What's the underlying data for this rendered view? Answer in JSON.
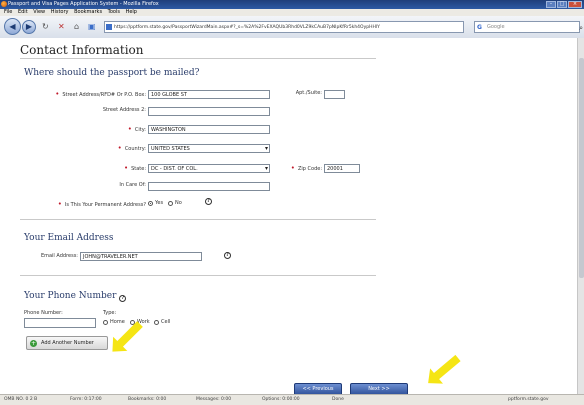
{
  "window": {
    "title": "Passport and Visa Pages Application System - Mozilla Firefox"
  },
  "menu": [
    "File",
    "Edit",
    "View",
    "History",
    "Bookmarks",
    "Tools",
    "Help"
  ],
  "browser": {
    "url": "https://pptform.state.gov/PassportWizardMain.aspx#?_s=%2A%2FvEXAQUb3Rhd0VLZ9kCAuB7pNIpKfRr5kh4OypHHlY",
    "search_placeholder": "Google",
    "search_badge": "G"
  },
  "page": {
    "title": "Contact Information",
    "mailing": {
      "heading": "Where should the passport be mailed?",
      "street_label": "Street Address/RFD# Or P.O. Box:",
      "street_value": "100 GLOBE ST",
      "apt_label": "Apt./Suite:",
      "apt_value": "",
      "street2_label": "Street Address 2:",
      "street2_value": "",
      "city_label": "City:",
      "city_value": "WASHINGTON",
      "country_label": "Country:",
      "country_value": "UNITED STATES",
      "state_label": "State:",
      "state_value": "DC - DIST. OF COL.",
      "zip_label": "Zip Code:",
      "zip_value": "20001",
      "care_of_label": "In Care Of:",
      "care_of_value": "",
      "permanent_label": "Is This Your Permanent Address?",
      "yes_label": "Yes",
      "no_label": "No"
    },
    "email": {
      "heading": "Your Email Address",
      "label": "Email Address:",
      "value": "JOHN@TRAVELER.NET"
    },
    "phone": {
      "heading": "Your Phone Number",
      "number_label": "Phone Number:",
      "type_label": "Type:",
      "home_label": "Home",
      "work_label": "Work",
      "cell_label": "Cell",
      "add_button": "Add Another Number"
    },
    "nav": {
      "previous": "<< Previous",
      "next": "Next >>"
    }
  },
  "status": {
    "items": [
      "OMB NO. 0 2 B",
      "Form: 0:17:00",
      "Bookmarks: 0:00",
      "Messages: 0:00",
      "Options: 0:00:00",
      "Done"
    ],
    "right": "pptform.state.gov"
  },
  "colors": {
    "required": "#c0182a",
    "nav_button": "#2d4f98",
    "arrow": "#f5e514"
  }
}
